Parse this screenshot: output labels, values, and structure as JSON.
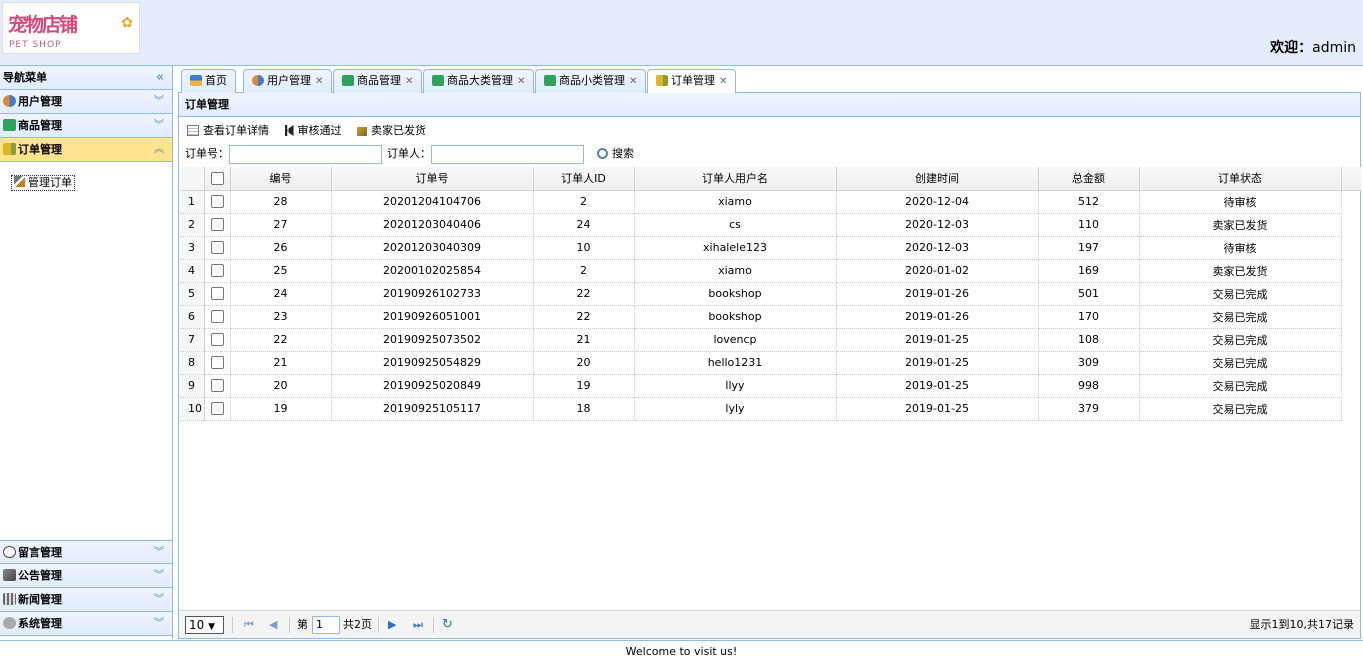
{
  "header": {
    "logo_cn": "宠物店铺",
    "logo_en": "PET SHOP",
    "welcome_prefix": "欢迎：",
    "username": "admin"
  },
  "nav": {
    "title": "导航菜单",
    "groups": [
      {
        "label": "用户管理",
        "icon": "users-icon"
      },
      {
        "label": "商品管理",
        "icon": "list-icon"
      },
      {
        "label": "订单管理",
        "icon": "chart-icon",
        "active": true
      }
    ],
    "active_item": "管理订单",
    "bottom_groups": [
      {
        "label": "留言管理",
        "icon": "comment-icon"
      },
      {
        "label": "公告管理",
        "icon": "book-icon"
      },
      {
        "label": "新闻管理",
        "icon": "news-icon"
      },
      {
        "label": "系统管理",
        "icon": "gear-icon"
      }
    ]
  },
  "tabs": [
    {
      "label": "首页",
      "icon": "home-icon",
      "closable": false
    },
    {
      "label": "用户管理",
      "icon": "users-icon",
      "closable": true
    },
    {
      "label": "商品管理",
      "icon": "list-icon",
      "closable": true
    },
    {
      "label": "商品大类管理",
      "icon": "list-icon",
      "closable": true
    },
    {
      "label": "商品小类管理",
      "icon": "list-icon",
      "closable": true
    },
    {
      "label": "订单管理",
      "icon": "chart-icon",
      "closable": true,
      "active": true
    }
  ],
  "panel": {
    "title": "订单管理",
    "toolbar": {
      "view_detail": "查看订单详情",
      "approve": "审核通过",
      "shipped": "卖家已发货"
    },
    "search": {
      "order_no_label": "订单号：",
      "orderer_label": "订单人：",
      "order_no_value": "",
      "orderer_value": "",
      "button": "搜索"
    }
  },
  "grid": {
    "columns": [
      "编号",
      "订单号",
      "订单人ID",
      "订单人用户名",
      "创建时间",
      "总金额",
      "订单状态"
    ],
    "rows": [
      [
        "1",
        "28",
        "20201204104706",
        "2",
        "xiamo",
        "2020-12-04",
        "512",
        "待审核"
      ],
      [
        "2",
        "27",
        "20201203040406",
        "24",
        "cs",
        "2020-12-03",
        "110",
        "卖家已发货"
      ],
      [
        "3",
        "26",
        "20201203040309",
        "10",
        "xihalele123",
        "2020-12-03",
        "197",
        "待审核"
      ],
      [
        "4",
        "25",
        "20200102025854",
        "2",
        "xiamo",
        "2020-01-02",
        "169",
        "卖家已发货"
      ],
      [
        "5",
        "24",
        "20190926102733",
        "22",
        "bookshop",
        "2019-01-26",
        "501",
        "交易已完成"
      ],
      [
        "6",
        "23",
        "20190926051001",
        "22",
        "bookshop",
        "2019-01-26",
        "170",
        "交易已完成"
      ],
      [
        "7",
        "22",
        "20190925073502",
        "21",
        "lovencp",
        "2019-01-25",
        "108",
        "交易已完成"
      ],
      [
        "8",
        "21",
        "20190925054829",
        "20",
        "hello1231",
        "2019-01-25",
        "309",
        "交易已完成"
      ],
      [
        "9",
        "20",
        "20190925020849",
        "19",
        "llyy",
        "2019-01-25",
        "998",
        "交易已完成"
      ],
      [
        "10",
        "19",
        "20190925105117",
        "18",
        "lyly",
        "2019-01-25",
        "379",
        "交易已完成"
      ]
    ]
  },
  "pager": {
    "page_size": "10",
    "page_prefix": "第",
    "current_page": "1",
    "total_pages": "共2页",
    "info": "显示1到10,共17记录"
  },
  "footer": {
    "text": "Welcome to visit us!"
  },
  "colors": {
    "border": "#95b8e7",
    "header_bg": "#e3edfb",
    "active_group": "#ffe48d",
    "accent": "#4f7bbd"
  }
}
